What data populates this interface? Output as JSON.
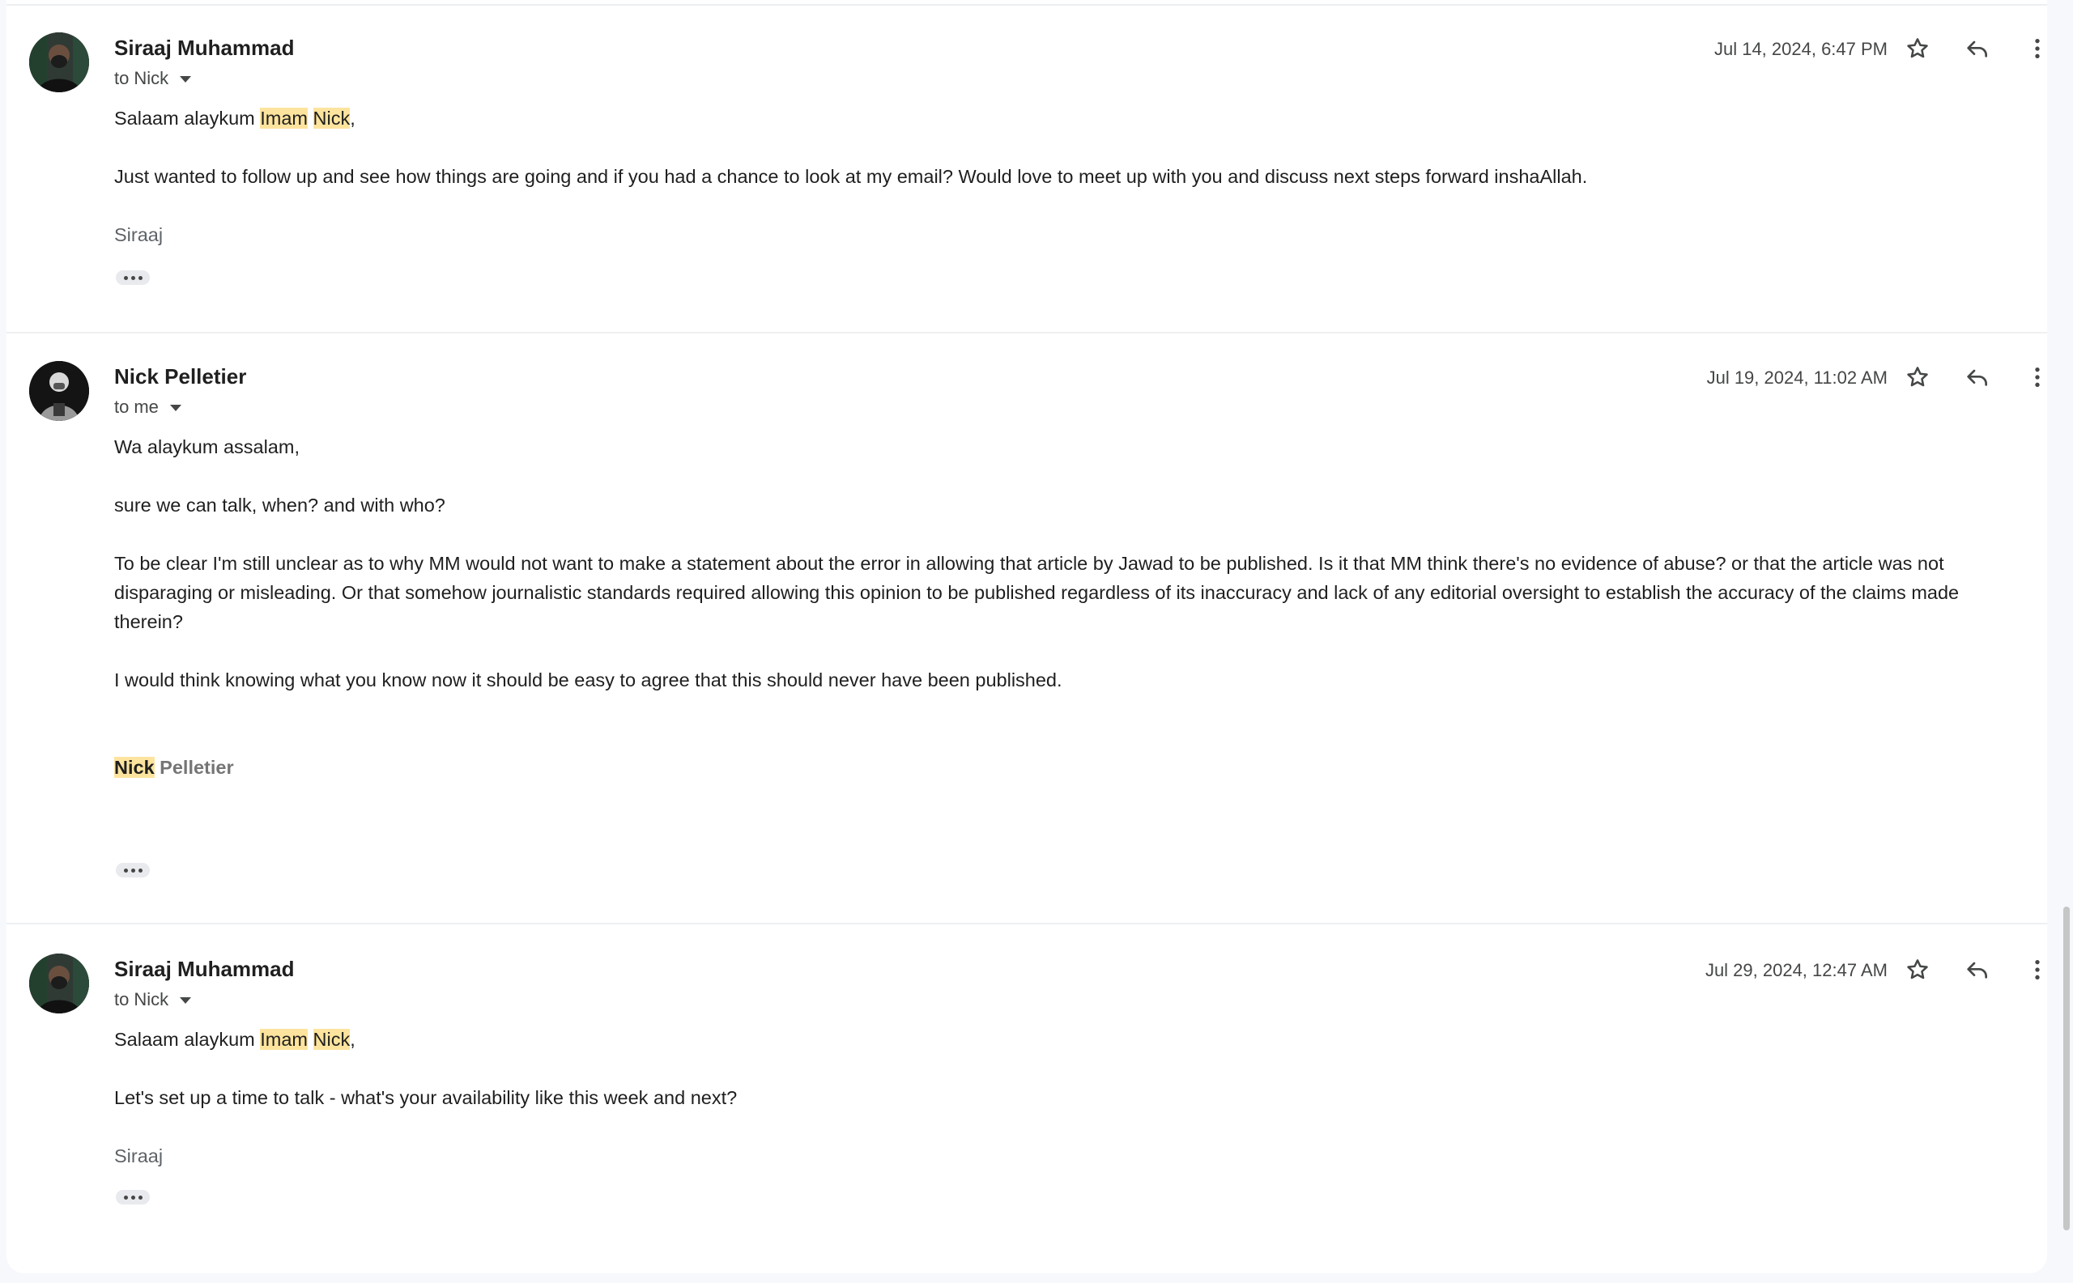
{
  "messages": [
    {
      "sender": "Siraaj Muhammad",
      "recipient_prefix": "to",
      "recipient": "Nick",
      "timestamp": "Jul 14, 2024, 6:47 PM",
      "greeting_pre": "Salaam alaykum ",
      "greeting_hl1": "Imam",
      "greeting_mid": " ",
      "greeting_hl2": "Nick",
      "greeting_post": ",",
      "paragraphs": [
        "Just wanted to follow up and see how things are going and if you had a chance to look at my email? Would love to meet up with you and discuss next steps forward inshaAllah."
      ],
      "signature": "Siraaj"
    },
    {
      "sender": "Nick Pelletier",
      "recipient_prefix": "to",
      "recipient": "me",
      "timestamp": "Jul 19, 2024, 11:02 AM",
      "paragraphs": [
        "Wa alaykum assalam,",
        "sure we can talk, when? and with who?",
        "To be clear I'm still unclear as to why MM would not want to make a statement about the error in allowing that article by Jawad to be published.  Is it that MM think there's no evidence of abuse? or that the article was not disparaging or misleading.  Or that somehow journalistic standards required allowing this opinion to be published regardless of its inaccuracy and lack of any editorial oversight to establish the accuracy of the claims made therein?",
        "I would think knowing what you know now it should be easy to agree that this should never have been published."
      ],
      "signature_first": "Nick",
      "signature_last": " Pelletier"
    },
    {
      "sender": "Siraaj Muhammad",
      "recipient_prefix": "to",
      "recipient": "Nick",
      "timestamp": "Jul 29, 2024, 12:47 AM",
      "greeting_pre": "Salaam alaykum ",
      "greeting_hl1": "Imam",
      "greeting_mid": " ",
      "greeting_hl2": "Nick",
      "greeting_post": ",",
      "paragraphs": [
        "Let's set up a time to talk - what's your availability like this week and next?"
      ],
      "signature": "Siraaj"
    }
  ],
  "icons": {
    "star": "star-icon",
    "reply": "reply-icon",
    "more": "more-vert-icon",
    "expand": "ellipsis-icon"
  },
  "colors": {
    "highlight": "#fde49e",
    "background": "#f6f8fc"
  }
}
